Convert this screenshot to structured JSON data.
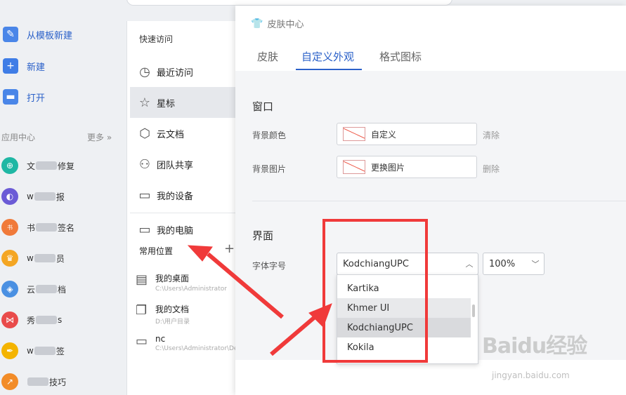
{
  "left_sidebar": {
    "actions": [
      {
        "label": "从模板新建",
        "icon": "template-icon",
        "color": "#4a86e8"
      },
      {
        "label": "新建",
        "icon": "plus-icon",
        "color": "#3f7de6"
      },
      {
        "label": "打开",
        "icon": "folder-icon",
        "color": "#4a86e8"
      }
    ],
    "app_center_label": "应用中心",
    "more_label": "更多 »",
    "apps": [
      {
        "label_prefix": "文",
        "label_suffix": "修复",
        "color": "#1fb7a4",
        "icon": "repair-icon"
      },
      {
        "label_prefix": "w",
        "label_suffix": "报",
        "color": "#6b5bd6",
        "icon": "report-icon"
      },
      {
        "label_prefix": "书",
        "label_suffix": "签名",
        "color": "#f07a3a",
        "icon": "signature-icon"
      },
      {
        "label_prefix": "w",
        "label_suffix": "员",
        "color": "#f4a623",
        "icon": "crown-icon"
      },
      {
        "label_prefix": "云",
        "label_suffix": "档",
        "color": "#4a90e2",
        "icon": "cube-icon"
      },
      {
        "label_prefix": "秀",
        "label_suffix": "s",
        "color": "#e94b4b",
        "icon": "bowtie-icon"
      },
      {
        "label_prefix": "w",
        "label_suffix": "签",
        "color": "#f4b400",
        "icon": "feather-icon"
      },
      {
        "label_prefix": "",
        "label_suffix": "技巧",
        "color": "#f28c28",
        "icon": "chart-icon"
      }
    ]
  },
  "middle_panel": {
    "quick_access_label": "快速访问",
    "items": [
      {
        "label": "最近访问",
        "icon": "clock-icon"
      },
      {
        "label": "星标",
        "icon": "star-icon"
      },
      {
        "label": "云文档",
        "icon": "cube-icon"
      },
      {
        "label": "团队共享",
        "icon": "team-icon"
      },
      {
        "label": "我的设备",
        "icon": "device-icon"
      },
      {
        "label": "我的电脑",
        "icon": "computer-icon"
      }
    ],
    "common_locations_label": "常用位置",
    "add_label": "+",
    "locations": [
      {
        "title": "我的桌面",
        "path": "C:\\Users\\Administrator",
        "icon": "desktop-icon"
      },
      {
        "title": "我的文档",
        "path": "D:\\用户目录",
        "icon": "document-icon"
      },
      {
        "title": "nc",
        "path": "C:\\Users\\Administrator\\Desk",
        "icon": "folder-icon"
      }
    ]
  },
  "skin_dialog": {
    "title": "皮肤中心",
    "tabs": [
      "皮肤",
      "自定义外观",
      "格式图标"
    ],
    "window_section": "窗口",
    "bg_color_label": "背景颜色",
    "bg_color_value": "自定义",
    "clear_label": "清除",
    "bg_image_label": "背景图片",
    "bg_image_value": "更换图片",
    "delete_label": "删除",
    "ui_section": "界面",
    "font_label": "字体字号",
    "font_value": "KodchiangUPC",
    "size_value": "100%",
    "font_options": [
      "Kartika",
      "Khmer UI",
      "KodchiangUPC",
      "Kokila"
    ]
  },
  "watermark": {
    "brand": "Baidu经验",
    "url": "jingyan.baidu.com"
  },
  "annotation_color": "#f03a3a"
}
